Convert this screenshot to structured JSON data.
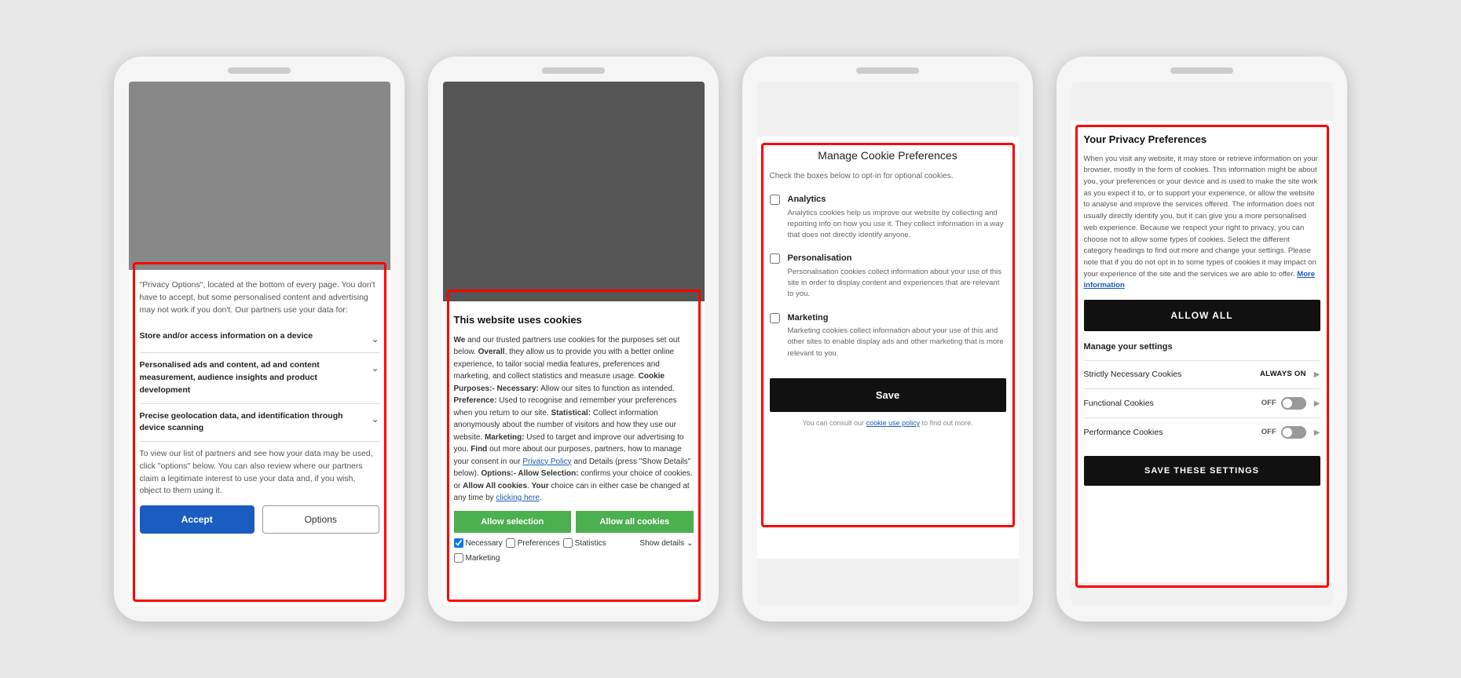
{
  "phone1": {
    "intro_text": "\"Privacy Options\", located at the bottom of every page. You don't have to accept, but some personalised content and advertising may not work if you don't. Our partners use your data for:",
    "accordion": [
      {
        "label": "Store and/or access information on a device"
      },
      {
        "label": "Personalised ads and content, ad and content measurement, audience insights and product development"
      },
      {
        "label": "Precise geolocation data, and identification through device scanning"
      }
    ],
    "note": "To view our list of partners and see how your data may be used, click \"options\" below. You can also review where our partners claim a legitimate interest to use your data and, if you wish, object to them using it.",
    "btn_accept": "Accept",
    "btn_options": "Options"
  },
  "phone2": {
    "title": "This website uses cookies",
    "body": "We and our trusted partners use cookies for the purposes set out below. Overall, they allow us to provide you with a better online experience, to tailor social media features, preferences and marketing, and collect statistics and measure usage. Cookie Purposes:- Necessary: Allow our sites to function as intended. Preference: Used to recognise and remember your preferences when you return to our site. Statistical: Collect information anonymously about the number of visitors and how they use our website. Marketing: Used to target and improve our advertising to you. Find out more about our purposes, partners, how to manage your consent in our Privacy Policy and Details (press \"Show Details\" below). Options:- Allow Selection: confirms your choice of cookies. or Allow All cookies. Your choice can in either case be changed at any time by clicking here.",
    "btn_allow_selection": "Allow selection",
    "btn_allow_all": "Allow all cookies",
    "checkboxes": [
      {
        "label": "Necessary",
        "checked": true
      },
      {
        "label": "Preferences",
        "checked": false
      },
      {
        "label": "Statistics",
        "checked": false
      },
      {
        "label": "Marketing",
        "checked": false
      }
    ],
    "show_details": "Show details"
  },
  "phone3": {
    "title": "Manage Cookie Preferences",
    "subtitle": "Check the boxes below to opt-in for optional cookies.",
    "cookies": [
      {
        "label": "Analytics",
        "desc": "Analytics cookies help us improve our website by collecting and reporting info on how you use it. They collect information in a way that does not directly identify anyone."
      },
      {
        "label": "Personalisation",
        "desc": "Personalisation cookies collect information about your use of this site in order to display content and experiences that are relevant to you."
      },
      {
        "label": "Marketing",
        "desc": "Marketing cookies collect information about your use of this and other sites to enable display ads and other marketing that is more relevant to you."
      }
    ],
    "save_btn": "Save",
    "footer": "You can consult our cookie use policy to find out more."
  },
  "phone4": {
    "title": "Your Privacy Preferences",
    "intro": "When you visit any website, it may store or retrieve information on your browser, mostly in the form of cookies. This information might be about you, your preferences or your device and is used to make the site work as you expect it to, or to support your experience, or allow the website to analyse and improve the services offered. The information does not usually directly identify you, but it can give you a more personalised web experience. Because we respect your right to privacy, you can choose not to allow some types of cookies. Select the different category headings to find out more and change your settings. Please note that if you do not opt in to some types of cookies it may impact on your experience of the site and the services we are able to offer.",
    "more_info": "More information",
    "allow_all_btn": "ALLOW ALL",
    "manage_heading": "Manage your settings",
    "toggle_rows": [
      {
        "label": "Strictly Necessary Cookies",
        "status": "ALWAYS ON",
        "toggle_type": "always_on"
      },
      {
        "label": "Functional Cookies",
        "status": "OFF",
        "toggle_type": "off"
      },
      {
        "label": "Performance Cookies",
        "status": "OFF",
        "toggle_type": "off"
      }
    ],
    "save_btn": "SAVE THESE SETTINGS"
  }
}
